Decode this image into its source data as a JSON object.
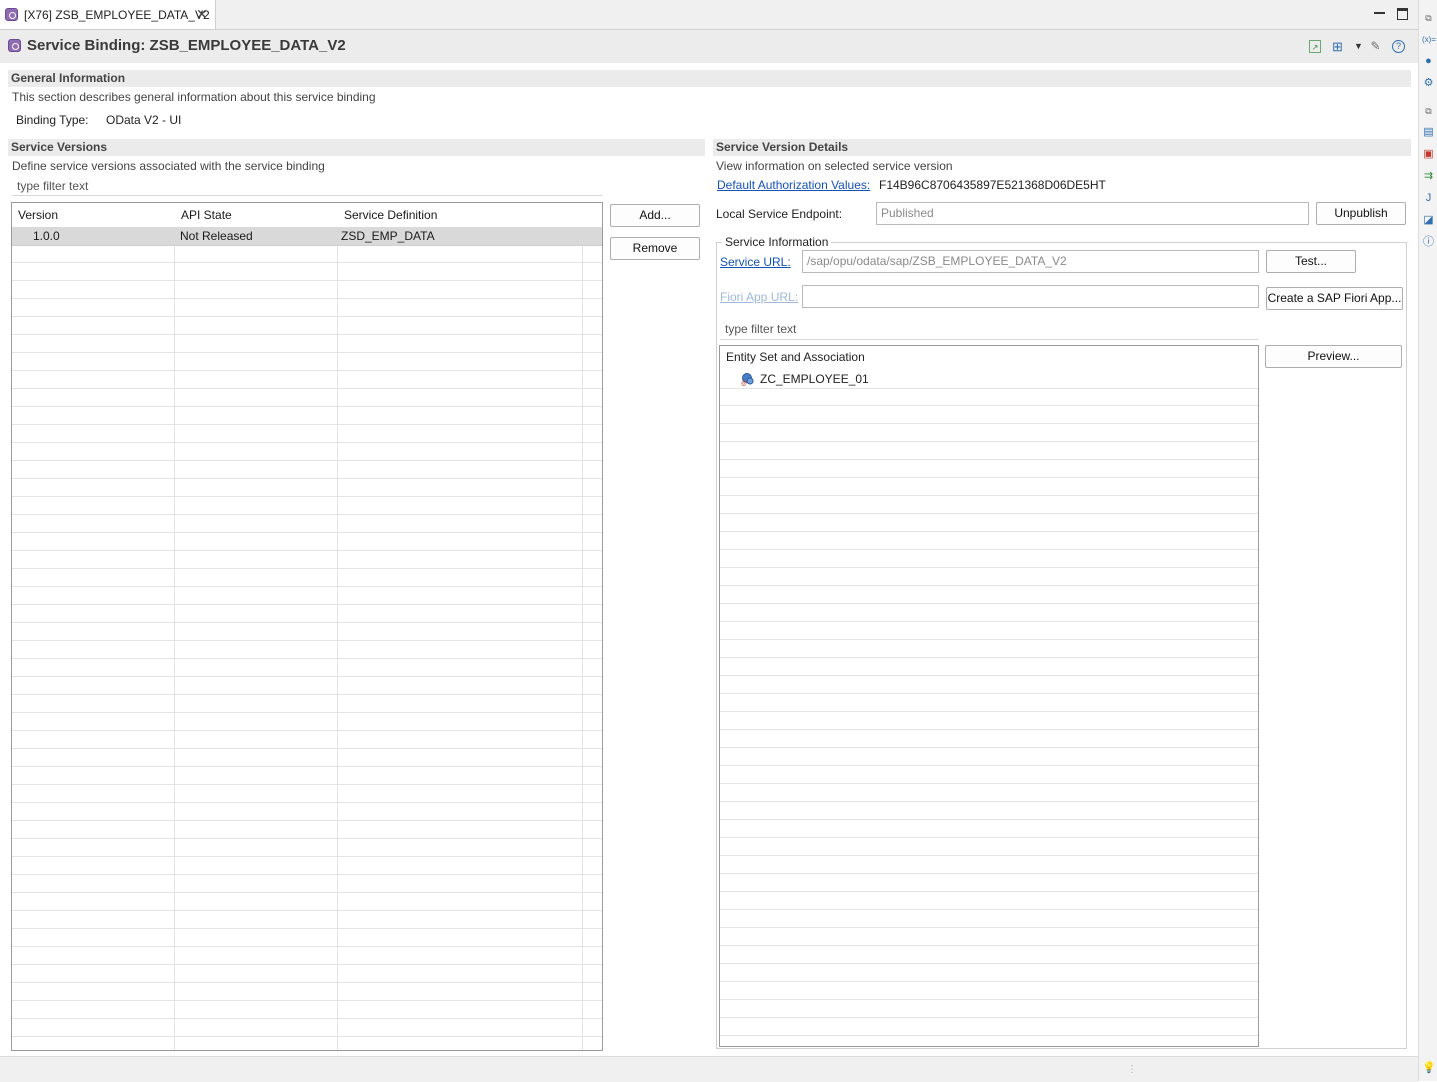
{
  "tab": {
    "label": "[X76] ZSB_EMPLOYEE_DATA_V2",
    "close": "✕"
  },
  "header": {
    "title": "Service Binding: ZSB_EMPLOYEE_DATA_V2"
  },
  "general": {
    "title": "General Information",
    "description": "This section describes general information about this service binding",
    "binding_type_label": "Binding Type:",
    "binding_type_value": "OData V2 - UI"
  },
  "versions": {
    "title": "Service Versions",
    "description": "Define service versions associated with the service binding",
    "filter_placeholder": "type filter text",
    "columns": [
      "Version",
      "API State",
      "Service Definition"
    ],
    "rows": [
      {
        "version": "1.0.0",
        "api_state": "Not Released",
        "service_definition": "ZSD_EMP_DATA"
      }
    ],
    "add_label": "Add...",
    "remove_label": "Remove"
  },
  "details": {
    "title": "Service Version Details",
    "description": "View information on selected service version",
    "auth_label": "Default Authorization Values:",
    "auth_value": "F14B96C8706435897E521368D06DE5HT",
    "endpoint_label": "Local Service Endpoint:",
    "endpoint_value": "Published",
    "unpublish_label": "Unpublish",
    "service_info_title": "Service Information",
    "service_url_label": "Service URL:",
    "service_url_value": "/sap/opu/odata/sap/ZSB_EMPLOYEE_DATA_V2",
    "test_label": "Test...",
    "fiori_label": "Fiori App URL:",
    "fiori_value": "",
    "create_fiori_label": "Create a SAP Fiori App...",
    "filter_placeholder": "type filter text",
    "entity_header": "Entity Set and Association",
    "entities": [
      "ZC_EMPLOYEE_01"
    ],
    "preview_label": "Preview..."
  },
  "colors": {
    "link": "#1552b5",
    "section_bg": "#ebebeb",
    "selected_row": "#d9d9d9"
  }
}
